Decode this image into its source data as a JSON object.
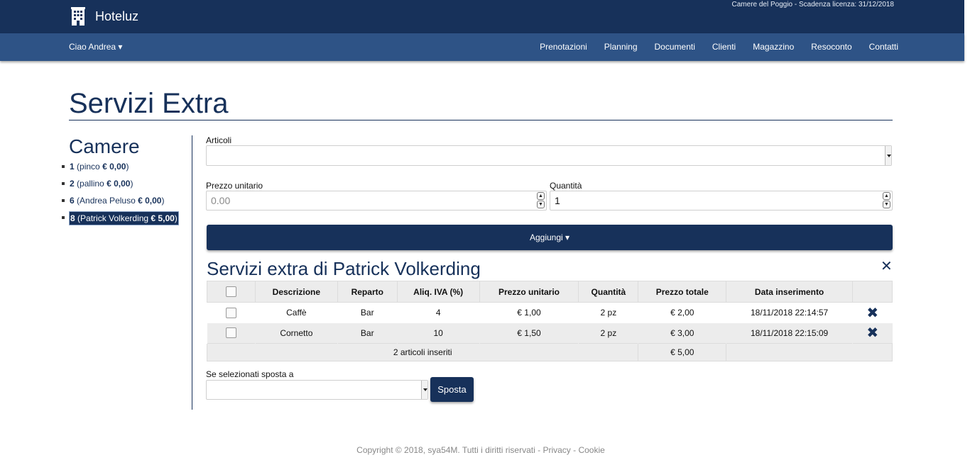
{
  "app": {
    "name": "Hoteluz",
    "license_info": "Camere del Poggio - Scadenza licenza: 31/12/2018",
    "greeting": "Ciao Andrea ▾"
  },
  "nav": {
    "items": [
      "Prenotazioni",
      "Planning",
      "Documenti",
      "Clienti",
      "Magazzino",
      "Resoconto",
      "Contatti"
    ]
  },
  "page": {
    "title": "Servizi Extra"
  },
  "sidebar": {
    "heading": "Camere",
    "rooms": [
      {
        "number": "1",
        "name": "pinco",
        "amount": "€ 0,00",
        "active": false
      },
      {
        "number": "2",
        "name": "pallino",
        "amount": "€ 0,00",
        "active": false
      },
      {
        "number": "6",
        "name": "Andrea Peluso",
        "amount": "€ 0,00",
        "active": false
      },
      {
        "number": "8",
        "name": "Patrick Volkerding",
        "amount": "€ 5,00",
        "active": true
      }
    ]
  },
  "form": {
    "articoli_label": "Articoli",
    "prezzo_label": "Prezzo unitario",
    "prezzo_placeholder": "0.00",
    "quantita_label": "Quantità",
    "quantita_value": "1",
    "add_button": "Aggiungi ▾"
  },
  "extras": {
    "title": "Servizi extra di Patrick Volkerding",
    "close_icon": "✕",
    "columns": [
      "Descrizione",
      "Reparto",
      "Aliq. IVA (%)",
      "Prezzo unitario",
      "Quantità",
      "Prezzo totale",
      "Data inserimento"
    ],
    "rows": [
      {
        "descrizione": "Caffè",
        "reparto": "Bar",
        "iva": "4",
        "prezzo": "€ 1,00",
        "quantita": "2 pz",
        "totale": "€ 2,00",
        "data": "18/11/2018 22:14:57"
      },
      {
        "descrizione": "Cornetto",
        "reparto": "Bar",
        "iva": "10",
        "prezzo": "€ 1,50",
        "quantita": "2 pz",
        "totale": "€ 3,00",
        "data": "18/11/2018 22:15:09"
      }
    ],
    "summary": "2 articoli inseriti",
    "summary_total": "€ 5,00",
    "delete_icon": "✖"
  },
  "move": {
    "label": "Se selezionati sposta a",
    "button": "Sposta"
  },
  "footer": {
    "copyright": "Copyright © 2018, sya54M. Tutti i diritti riservati",
    "sep": " - ",
    "privacy": "Privacy",
    "cookie": "Cookie"
  }
}
